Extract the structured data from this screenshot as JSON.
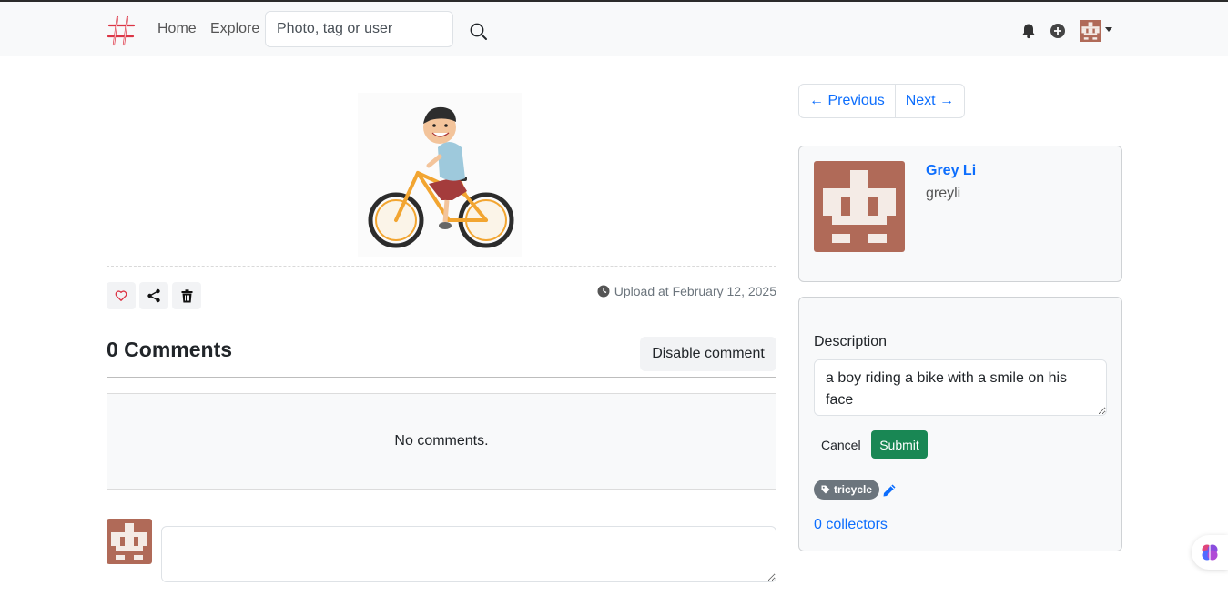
{
  "nav": {
    "home_label": "Home",
    "explore_label": "Explore",
    "search_placeholder": "Photo, tag or user",
    "icons": [
      "hashtag-logo-icon",
      "search-icon",
      "bell-icon",
      "plus-circle-icon",
      "avatar-icon",
      "caret-down-icon"
    ]
  },
  "photo": {
    "upload_text": "Upload at February 12, 2025",
    "actions": [
      "heart-icon",
      "share-icon",
      "trash-icon"
    ]
  },
  "comments": {
    "title": "0 Comments",
    "disable_label": "Disable comment",
    "empty_text": "No comments.",
    "input_value": ""
  },
  "pager": {
    "previous_label": "← Previous",
    "next_label": "Next →"
  },
  "profile": {
    "name": "Grey Li",
    "username": "greyli"
  },
  "description": {
    "label": "Description",
    "value": "a boy riding a bike with a smile on his face",
    "cancel_label": "Cancel",
    "submit_label": "Submit"
  },
  "tags": [
    {
      "label": "tricycle"
    }
  ],
  "collectors_label": "0 collectors",
  "colors": {
    "brand_red": "#dc3545",
    "link_blue": "#0d6efd",
    "submit_green": "#198754",
    "avatar_brown": "#b06a58",
    "tag_gray": "#6c757d"
  }
}
